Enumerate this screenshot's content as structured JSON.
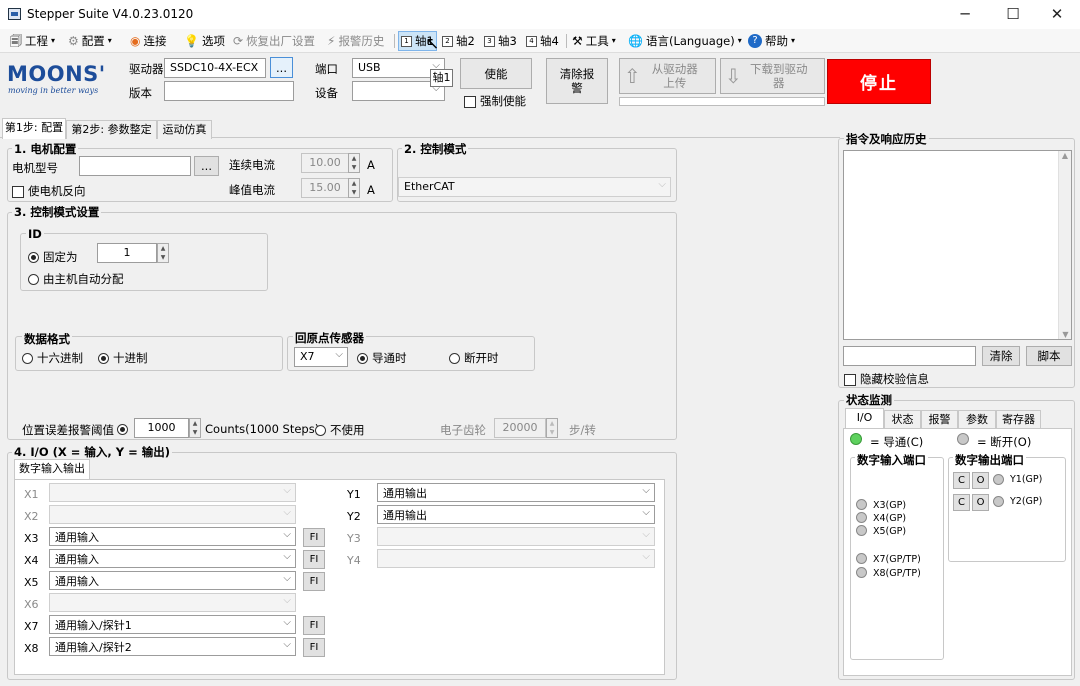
{
  "window": {
    "title": "Stepper Suite V4.0.23.0120"
  },
  "menu": {
    "project": "工程",
    "config": "配置",
    "connect": "连接",
    "options": "选项",
    "restore": "恢复出厂设置",
    "alarm_history": "报警历史",
    "axis1": "轴1",
    "axis2": "轴2",
    "axis3": "轴3",
    "axis4": "轴4",
    "tools": "工具",
    "language": "语言(Language)",
    "help": "帮助"
  },
  "toolbar": {
    "brand": "MOONS'",
    "tagline": "moving in better ways",
    "drive_label": "驱动器",
    "drive_value": "SSDC10-4X-ECX",
    "browse": "...",
    "version_label": "版本",
    "version_value": "",
    "port_label": "端口",
    "port_value": "USB",
    "device_label": "设备",
    "device_value": "",
    "enable": "使能",
    "force_enable": "强制使能",
    "clear_alarm": "清除报警",
    "upload": "从驱动器上传",
    "download": "下载到驱动器",
    "stop": "停止",
    "tooltip": "轴1"
  },
  "steps": {
    "tab1": "第1步: 配置",
    "tab2": "第2步: 参数整定",
    "tab3": "运动仿真"
  },
  "motor": {
    "title": "1. 电机配置",
    "model_label": "电机型号",
    "model_value": "",
    "browse": "...",
    "reverse": "使电机反向",
    "cont_current_label": "连续电流",
    "cont_current": "10.00",
    "unit1": "A",
    "peak_current_label": "峰值电流",
    "peak_current": "15.00",
    "unit2": "A"
  },
  "control_mode": {
    "title": "2. 控制模式",
    "value": "EtherCAT"
  },
  "mode_settings": {
    "title": "3. 控制模式设置",
    "id_title": "ID",
    "fixed_label": "固定为",
    "fixed_value": "1",
    "auto_assign": "由主机自动分配",
    "data_format_title": "数据格式",
    "hex": "十六进制",
    "dec": "十进制",
    "home_title": "回原点传感器",
    "home_input": "X7",
    "closed": "导通时",
    "open": "断开时",
    "pos_err_label": "位置误差报警阈值",
    "pos_err_value": "1000",
    "pos_err_unit": "Counts(1000 Steps)",
    "not_used": "不使用",
    "gear_label": "电子齿轮",
    "gear_value": "20000",
    "gear_unit": "步/转"
  },
  "io": {
    "title": "4. I/O (X = 输入, Y = 输出)",
    "tab": "数字输入输出",
    "fi": "FI",
    "inputs": [
      {
        "name": "X1",
        "value": ""
      },
      {
        "name": "X2",
        "value": ""
      },
      {
        "name": "X3",
        "value": "通用输入"
      },
      {
        "name": "X4",
        "value": "通用输入"
      },
      {
        "name": "X5",
        "value": "通用输入"
      },
      {
        "name": "X6",
        "value": ""
      },
      {
        "name": "X7",
        "value": "通用输入/探针1"
      },
      {
        "name": "X8",
        "value": "通用输入/探针2"
      }
    ],
    "outputs": [
      {
        "name": "Y1",
        "value": "通用输出"
      },
      {
        "name": "Y2",
        "value": "通用输出"
      },
      {
        "name": "Y3",
        "value": ""
      },
      {
        "name": "Y4",
        "value": ""
      }
    ]
  },
  "history": {
    "title": "指令及响应历史",
    "input_value": "",
    "clear": "清除",
    "script": "脚本",
    "hide_checksum": "隐藏校验信息"
  },
  "status": {
    "title": "状态监测",
    "tabs": [
      "I/O",
      "状态",
      "报警",
      "参数",
      "寄存器"
    ],
    "legend_on": "= 导通(C)",
    "legend_off": "= 断开(O)",
    "inputs_title": "数字输入端口",
    "outputs_title": "数字输出端口",
    "inputs": [
      "X3(GP)",
      "X4(GP)",
      "X5(GP)",
      "X7(GP/TP)",
      "X8(GP/TP)"
    ],
    "outputs": [
      "Y1(GP)",
      "Y2(GP)"
    ],
    "c": "C",
    "o": "O"
  },
  "colors": {
    "stop_bg": "#ff0000",
    "brand": "#1d4d9a",
    "led_on": "#5ed15e",
    "led_off": "#c8c8c8"
  }
}
